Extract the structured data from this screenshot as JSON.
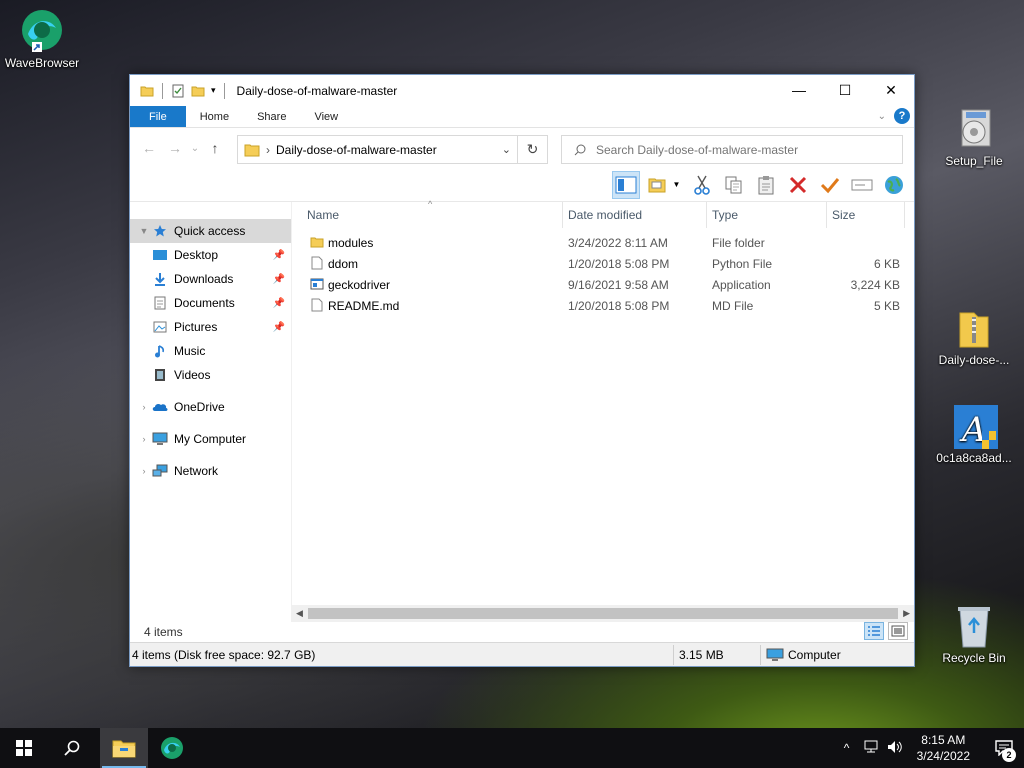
{
  "desktop": {
    "icons": [
      {
        "label": "WaveBrowser"
      },
      {
        "label": "Setup_File"
      },
      {
        "label": "Daily-dose-..."
      },
      {
        "label": "0c1a8ca8ad..."
      },
      {
        "label": "Recycle Bin"
      }
    ]
  },
  "window": {
    "title": "Daily-dose-of-malware-master",
    "controls": {
      "minimize": "—",
      "maximize": "☐",
      "close": "✕"
    }
  },
  "ribbon": {
    "tabs": [
      {
        "label": "File"
      },
      {
        "label": "Home"
      },
      {
        "label": "Share"
      },
      {
        "label": "View"
      }
    ],
    "help": "?"
  },
  "navigation": {
    "back": "←",
    "forward": "→",
    "recent": "⌄",
    "up": "↑",
    "address": "Daily-dose-of-malware-master",
    "breadcrumb_sep": "›",
    "dropdown": "⌄",
    "refresh": "↻",
    "search_placeholder": "Search Daily-dose-of-malware-master"
  },
  "sidebar": {
    "items": [
      {
        "label": "Quick access",
        "icon": "star-icon"
      },
      {
        "label": "Desktop",
        "icon": "desktop-icon"
      },
      {
        "label": "Downloads",
        "icon": "download-icon"
      },
      {
        "label": "Documents",
        "icon": "documents-icon"
      },
      {
        "label": "Pictures",
        "icon": "pictures-icon"
      },
      {
        "label": "Music",
        "icon": "music-icon"
      },
      {
        "label": "Videos",
        "icon": "videos-icon"
      },
      {
        "label": "OneDrive",
        "icon": "cloud-icon"
      },
      {
        "label": "My Computer",
        "icon": "computer-icon"
      },
      {
        "label": "Network",
        "icon": "network-icon"
      }
    ]
  },
  "columns": {
    "name": "Name",
    "date": "Date modified",
    "type": "Type",
    "size": "Size"
  },
  "files": [
    {
      "name": "modules",
      "date": "3/24/2022 8:11 AM",
      "type": "File folder",
      "size": "",
      "icon": "folder-icon"
    },
    {
      "name": "ddom",
      "date": "1/20/2018 5:08 PM",
      "type": "Python File",
      "size": "6 KB",
      "icon": "file-icon"
    },
    {
      "name": "geckodriver",
      "date": "9/16/2021 9:58 AM",
      "type": "Application",
      "size": "3,224 KB",
      "icon": "application-icon"
    },
    {
      "name": "README.md",
      "date": "1/20/2018 5:08 PM",
      "type": "MD File",
      "size": "5 KB",
      "icon": "file-icon"
    }
  ],
  "status": {
    "count": "4 items",
    "details": "4 items (Disk free space: 92.7 GB)",
    "size": "3.15 MB",
    "location": "Computer"
  },
  "taskbar": {
    "time": "8:15 AM",
    "date": "3/24/2022",
    "notifications": "2"
  },
  "colors": {
    "accent": "#1979ca",
    "selection": "#cce4f7"
  }
}
